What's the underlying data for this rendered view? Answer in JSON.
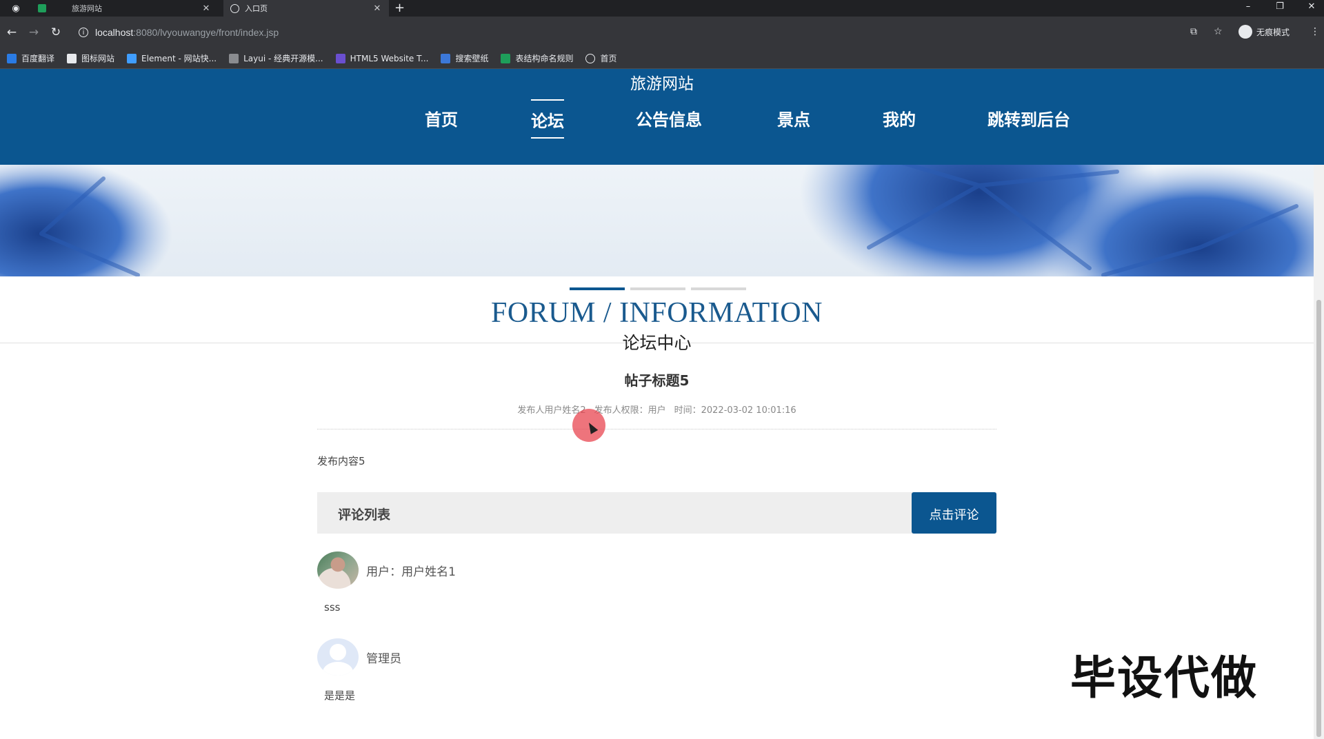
{
  "browser": {
    "tabs": [
      {
        "title": "旅游网站",
        "active": false
      },
      {
        "title": "入口页",
        "active": true
      }
    ],
    "url_host": "localhost",
    "url_path": ":8080/lvyouwangye/front/index.jsp",
    "profile_label": "无痕模式",
    "bookmarks": [
      {
        "label": "百度翻译",
        "icon": "translate-icon",
        "color": "#2a7be4"
      },
      {
        "label": "图标网站",
        "icon": "flag-icon",
        "color": "#e8eaed"
      },
      {
        "label": "Element - 网站快...",
        "icon": "element-icon",
        "color": "#409eff"
      },
      {
        "label": "Layui - 经典开源模...",
        "icon": "layui-icon",
        "color": "#8a8c90"
      },
      {
        "label": "HTML5 Website T...",
        "icon": "html5-icon",
        "color": "#6a4fd0"
      },
      {
        "label": "搜索壁纸",
        "icon": "wallpaper-icon",
        "color": "#3c78d8"
      },
      {
        "label": "表结构命名规则",
        "icon": "sheet-icon",
        "color": "#1e9e5a"
      },
      {
        "label": "首页",
        "icon": "globe-icon",
        "color": "#e8eaed"
      }
    ]
  },
  "site": {
    "title": "旅游网站",
    "nav": [
      {
        "label": "首页",
        "active": false
      },
      {
        "label": "论坛",
        "active": true
      },
      {
        "label": "公告信息",
        "active": false
      },
      {
        "label": "景点",
        "active": false
      },
      {
        "label": "我的",
        "active": false
      },
      {
        "label": "跳转到后台",
        "active": false
      }
    ]
  },
  "section": {
    "title_en": "FORUM / INFORMATION",
    "title_cn": "论坛中心"
  },
  "post": {
    "title": "帖子标题5",
    "meta_author": "发布人用户姓名2",
    "meta_role": "发布人权限：用户",
    "meta_time": "时间：2022-03-02 10:01:16",
    "content": "发布内容5"
  },
  "comments_section": {
    "title": "评论列表",
    "button_label": "点击评论",
    "items": [
      {
        "user": "用户：用户姓名1",
        "text": "sss",
        "avatar": "photo"
      },
      {
        "user": "管理员",
        "text": "是是是",
        "avatar": "default"
      }
    ]
  },
  "watermark": "毕设代做",
  "colors": {
    "header_bg": "#0b5690",
    "accent": "#0b5690",
    "section_title": "#1a5a8e"
  }
}
